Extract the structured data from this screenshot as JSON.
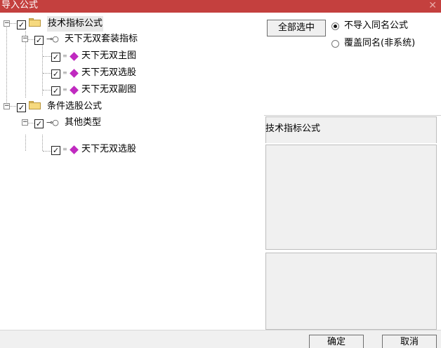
{
  "window": {
    "title": "导入公式",
    "close_glyph": "✕"
  },
  "tree": {
    "glyphs": {
      "collapse": "−",
      "check": "✓",
      "key": "⊸○",
      "gem_prefix": "≡"
    },
    "nodes": [
      {
        "id": "tech",
        "label": "技术指标公式",
        "level": 0,
        "icon": "folder-icon",
        "checked": true,
        "expanded": true,
        "selected": true
      },
      {
        "id": "suite",
        "label": "天下无双套装指标",
        "level": 1,
        "icon": "key-icon",
        "checked": true,
        "expanded": true
      },
      {
        "id": "main",
        "label": "天下无双主图",
        "level": 2,
        "icon": "gem-icon",
        "checked": true
      },
      {
        "id": "pick1",
        "label": "天下无双选股",
        "level": 2,
        "icon": "gem-icon",
        "checked": true
      },
      {
        "id": "sub",
        "label": "天下无双副图",
        "level": 2,
        "icon": "gem-icon",
        "checked": true
      },
      {
        "id": "cond",
        "label": "条件选股公式",
        "level": 0,
        "icon": "folder-icon",
        "checked": true,
        "expanded": true
      },
      {
        "id": "other",
        "label": "其他类型",
        "level": 1,
        "icon": "key-icon",
        "checked": true,
        "expanded": true
      },
      {
        "id": "pick2",
        "label": "天下无双选股",
        "level": 2,
        "icon": "gem-icon",
        "checked": true
      }
    ]
  },
  "right": {
    "select_all_label": "全部选中",
    "radio_no_import": "不导入同名公式",
    "radio_overwrite": "覆盖同名(非系统)",
    "selected_radio": "no_import",
    "info_title": "技术指标公式"
  },
  "footer": {
    "ok_label": "确定",
    "cancel_label": "取消"
  },
  "colors": {
    "titlebar": "#c4403e",
    "gem": "#c02ac0",
    "folder": "#f6d97e",
    "panel_bg": "#f0f0f0"
  }
}
